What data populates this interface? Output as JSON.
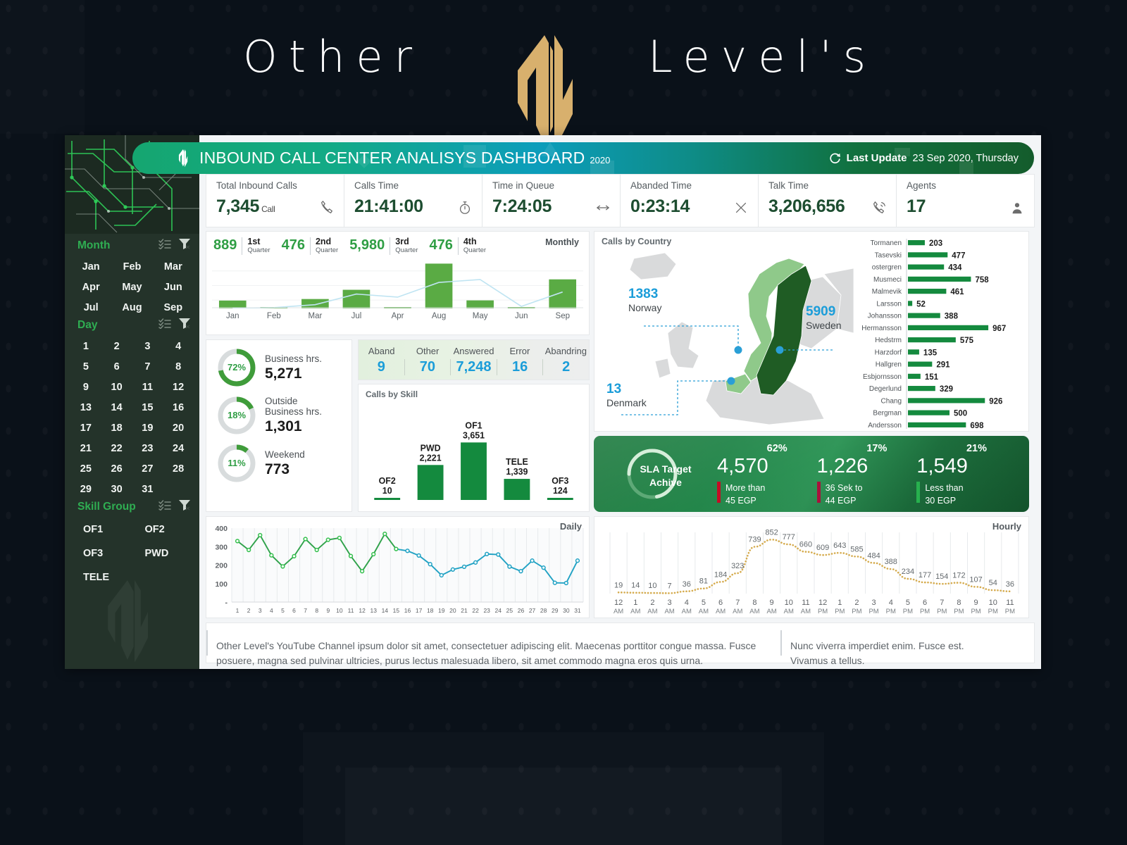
{
  "brand": {
    "left": "Other",
    "right": "Level's",
    "logo_icon": "ol-monogram-logo"
  },
  "header": {
    "logo_icon": "ol-mark-icon",
    "title": "INBOUND CALL CENTER ANALISYS DASHBOARD",
    "year": "2020",
    "refresh_icon": "refresh-icon",
    "last_update_label": "Last Update",
    "last_update_value": "23 Sep 2020, Thursday"
  },
  "kpis": [
    {
      "label": "Total Inbound Calls",
      "value": "7,345",
      "unit": "Call",
      "icon": "phone-handset-icon"
    },
    {
      "label": "Calls Time",
      "value": "21:41:00",
      "unit": "",
      "icon": "stopwatch-icon"
    },
    {
      "label": "Time in Queue",
      "value": "7:24:05",
      "unit": "",
      "icon": "arrows-horizontal-icon"
    },
    {
      "label": "Abanded Time",
      "value": "0:23:14",
      "unit": "",
      "icon": "close-x-icon"
    },
    {
      "label": "Talk Time",
      "value": "3,206,656",
      "unit": "",
      "icon": "phone-waves-icon"
    },
    {
      "label": "Agents",
      "value": "17",
      "unit": "",
      "icon": "agent-person-icon"
    }
  ],
  "sidebar": {
    "filters": [
      {
        "title": "Month",
        "multiselect_icon": "multiselect-icon",
        "clear_filter_icon": "clear-filter-icon",
        "columns": 3,
        "items": [
          "Jan",
          "Feb",
          "Mar",
          "Apr",
          "May",
          "Jun",
          "Jul",
          "Aug",
          "Sep"
        ]
      },
      {
        "title": "Day",
        "multiselect_icon": "multiselect-icon",
        "clear_filter_icon": "clear-filter-icon",
        "columns": 4,
        "items": [
          "1",
          "2",
          "3",
          "4",
          "5",
          "6",
          "7",
          "8",
          "9",
          "10",
          "11",
          "12",
          "13",
          "14",
          "15",
          "16",
          "17",
          "18",
          "19",
          "20",
          "21",
          "22",
          "23",
          "24",
          "25",
          "26",
          "27",
          "28",
          "29",
          "30",
          "31"
        ]
      },
      {
        "title": "Skill Group",
        "multiselect_icon": "multiselect-icon",
        "clear_filter_icon": "clear-filter-icon",
        "columns": 2,
        "items": [
          "OF1",
          "OF2",
          "OF3",
          "PWD",
          "TELE"
        ]
      }
    ]
  },
  "quarters": [
    {
      "value": "889",
      "ord": "1st",
      "label": "Quarter"
    },
    {
      "value": "476",
      "ord": "2nd",
      "label": "Quarter"
    },
    {
      "value": "5,980",
      "ord": "3rd",
      "label": "Quarter"
    },
    {
      "value": "476",
      "ord": "4th",
      "label": "Quarter"
    }
  ],
  "donuts": [
    {
      "pct": "72%",
      "value": 72,
      "caption": "Business hrs.",
      "number": "5,271"
    },
    {
      "pct": "18%",
      "value": 18,
      "caption": "Outside\nBusiness hrs.",
      "number": "1,301"
    },
    {
      "pct": "11%",
      "value": 11,
      "caption": "Weekend",
      "number": "773"
    }
  ],
  "aband_strip": {
    "headers": [
      "Aband",
      "Other",
      "Answered",
      "Error",
      "Abandring"
    ],
    "values": [
      "9",
      "70",
      "7,248",
      "16",
      "2"
    ]
  },
  "map": {
    "title": "Calls by Country",
    "callouts": [
      {
        "value": "1383",
        "name": "Norway"
      },
      {
        "value": "5909",
        "name": "Sweden"
      },
      {
        "value": "13",
        "name": "Denmark"
      }
    ]
  },
  "sla": {
    "donut_caption_line1": "SLA Target",
    "donut_caption_line2": "Achive",
    "donut_value": 72,
    "columns": [
      {
        "pct": "62%",
        "value": "4,570",
        "sub1": "More than",
        "sub2": "45 EGP",
        "tick_color": "#c40d25"
      },
      {
        "pct": "17%",
        "value": "1,226",
        "sub1": "36 Sek to",
        "sub2": "44 EGP",
        "tick_color": "#a8123c"
      },
      {
        "pct": "21%",
        "value": "1,549",
        "sub1": "Less than",
        "sub2": "30 EGP",
        "tick_color": "#27b14e"
      }
    ]
  },
  "footer": {
    "left": "Other Level's YouTube Channel ipsum dolor sit amet, consectetuer adipiscing elit. Maecenas porttitor congue massa. Fusce posuere, magna sed pulvinar ultricies, purus lectus malesuada libero, sit amet commodo magna eros quis urna.",
    "right": "Nunc viverra imperdiet enim. Fusce est.\nVivamus a tellus."
  },
  "colors": {
    "green": "#2f9e44",
    "dark_green": "#148a3e",
    "blue": "#1b9dd9",
    "gold": "#d8b06d",
    "sidebar_bg": "#24332a"
  },
  "chart_data": [
    {
      "type": "bar",
      "title": "Monthly",
      "name": "monthly-calls",
      "categories": [
        "Jan",
        "Feb",
        "Mar",
        "Jul",
        "Apr",
        "Aug",
        "May",
        "Jun",
        "Sep"
      ],
      "values": [
        230,
        18,
        275,
        545,
        30,
        1310,
        235,
        22,
        850
      ],
      "series": [
        {
          "name": "bars",
          "values": [
            230,
            18,
            275,
            545,
            30,
            1310,
            235,
            22,
            850
          ]
        },
        {
          "name": "trend-line",
          "values": [
            5,
            25,
            110,
            420,
            330,
            760,
            845,
            60,
            480
          ]
        }
      ],
      "xlabel": "",
      "ylabel": "",
      "ylim": [
        0,
        1400
      ],
      "grid": true,
      "legend": "none"
    },
    {
      "type": "bar",
      "title": "Calls by Skill",
      "name": "calls-by-skill",
      "categories": [
        "OF2",
        "PWD",
        "OF1",
        "TELE",
        "OF3"
      ],
      "values": [
        10,
        2221,
        3651,
        1339,
        124
      ],
      "data_labels": [
        "10",
        "2,221",
        "3,651",
        "1,339",
        "124"
      ],
      "xlabel": "",
      "ylabel": "",
      "ylim": [
        0,
        3800
      ],
      "grid": false,
      "legend": "none"
    },
    {
      "type": "bar",
      "title": "Calls by Country",
      "name": "agent-calls-bars",
      "orientation": "horizontal",
      "categories": [
        "Tormanen",
        "Tasevski",
        "ostergren",
        "Musmeci",
        "Malmevik",
        "Larsson",
        "Johansson",
        "Hermansson",
        "Hedstrm",
        "Harzdorf",
        "Hallgren",
        "Esbjornsson",
        "Degerlund",
        "Chang",
        "Bergman",
        "Andersson"
      ],
      "values": [
        203,
        477,
        434,
        758,
        461,
        52,
        388,
        967,
        575,
        135,
        291,
        151,
        329,
        926,
        500,
        698
      ],
      "xlabel": "",
      "ylabel": "",
      "ylim": [
        0,
        1000
      ],
      "grid": false,
      "legend": "none"
    },
    {
      "type": "line",
      "title": "Daily",
      "name": "daily-calls",
      "x": [
        "1",
        "2",
        "3",
        "4",
        "5",
        "6",
        "7",
        "8",
        "9",
        "10",
        "11",
        "12",
        "13",
        "14",
        "15",
        "16",
        "17",
        "18",
        "19",
        "20",
        "21",
        "22",
        "23",
        "24",
        "25",
        "26",
        "27",
        "28",
        "29",
        "30",
        "31"
      ],
      "values": [
        330,
        282,
        362,
        253,
        193,
        248,
        341,
        282,
        337,
        347,
        249,
        167,
        259,
        369,
        287,
        277,
        252,
        205,
        145,
        176,
        191,
        214,
        260,
        257,
        192,
        167,
        224,
        186,
        104,
        103,
        224
      ],
      "xlabel": "",
      "ylabel": "",
      "ylim": [
        0,
        400
      ],
      "yticks": [
        "-",
        "100",
        "200",
        "300",
        "400"
      ],
      "grid": true,
      "legend": "none"
    },
    {
      "type": "area",
      "title": "Hourly",
      "name": "hourly-calls",
      "x": [
        "12 AM",
        "1 AM",
        "2 AM",
        "3 AM",
        "4 AM",
        "5 AM",
        "6 AM",
        "7 AM",
        "8 AM",
        "9 AM",
        "10 AM",
        "11 AM",
        "12 PM",
        "1 PM",
        "2 PM",
        "3 PM",
        "4 PM",
        "5 PM",
        "6 PM",
        "7 PM",
        "8 PM",
        "9 PM",
        "10 PM",
        "11 PM"
      ],
      "hours": [
        "12",
        "1",
        "2",
        "3",
        "4",
        "5",
        "6",
        "7",
        "8",
        "9",
        "10",
        "11",
        "12",
        "1",
        "2",
        "3",
        "4",
        "5",
        "6",
        "7",
        "8",
        "9",
        "10",
        "11"
      ],
      "meridiem": [
        "AM",
        "AM",
        "AM",
        "AM",
        "AM",
        "AM",
        "AM",
        "AM",
        "AM",
        "AM",
        "AM",
        "AM",
        "PM",
        "PM",
        "PM",
        "PM",
        "PM",
        "PM",
        "PM",
        "PM",
        "PM",
        "PM",
        "PM",
        "PM"
      ],
      "values": [
        19,
        14,
        10,
        7,
        36,
        81,
        184,
        323,
        739,
        852,
        777,
        660,
        609,
        643,
        585,
        484,
        388,
        234,
        177,
        154,
        172,
        107,
        54,
        36
      ],
      "xlabel": "",
      "ylabel": "",
      "ylim": [
        0,
        900
      ],
      "grid": true,
      "legend": "none"
    }
  ]
}
